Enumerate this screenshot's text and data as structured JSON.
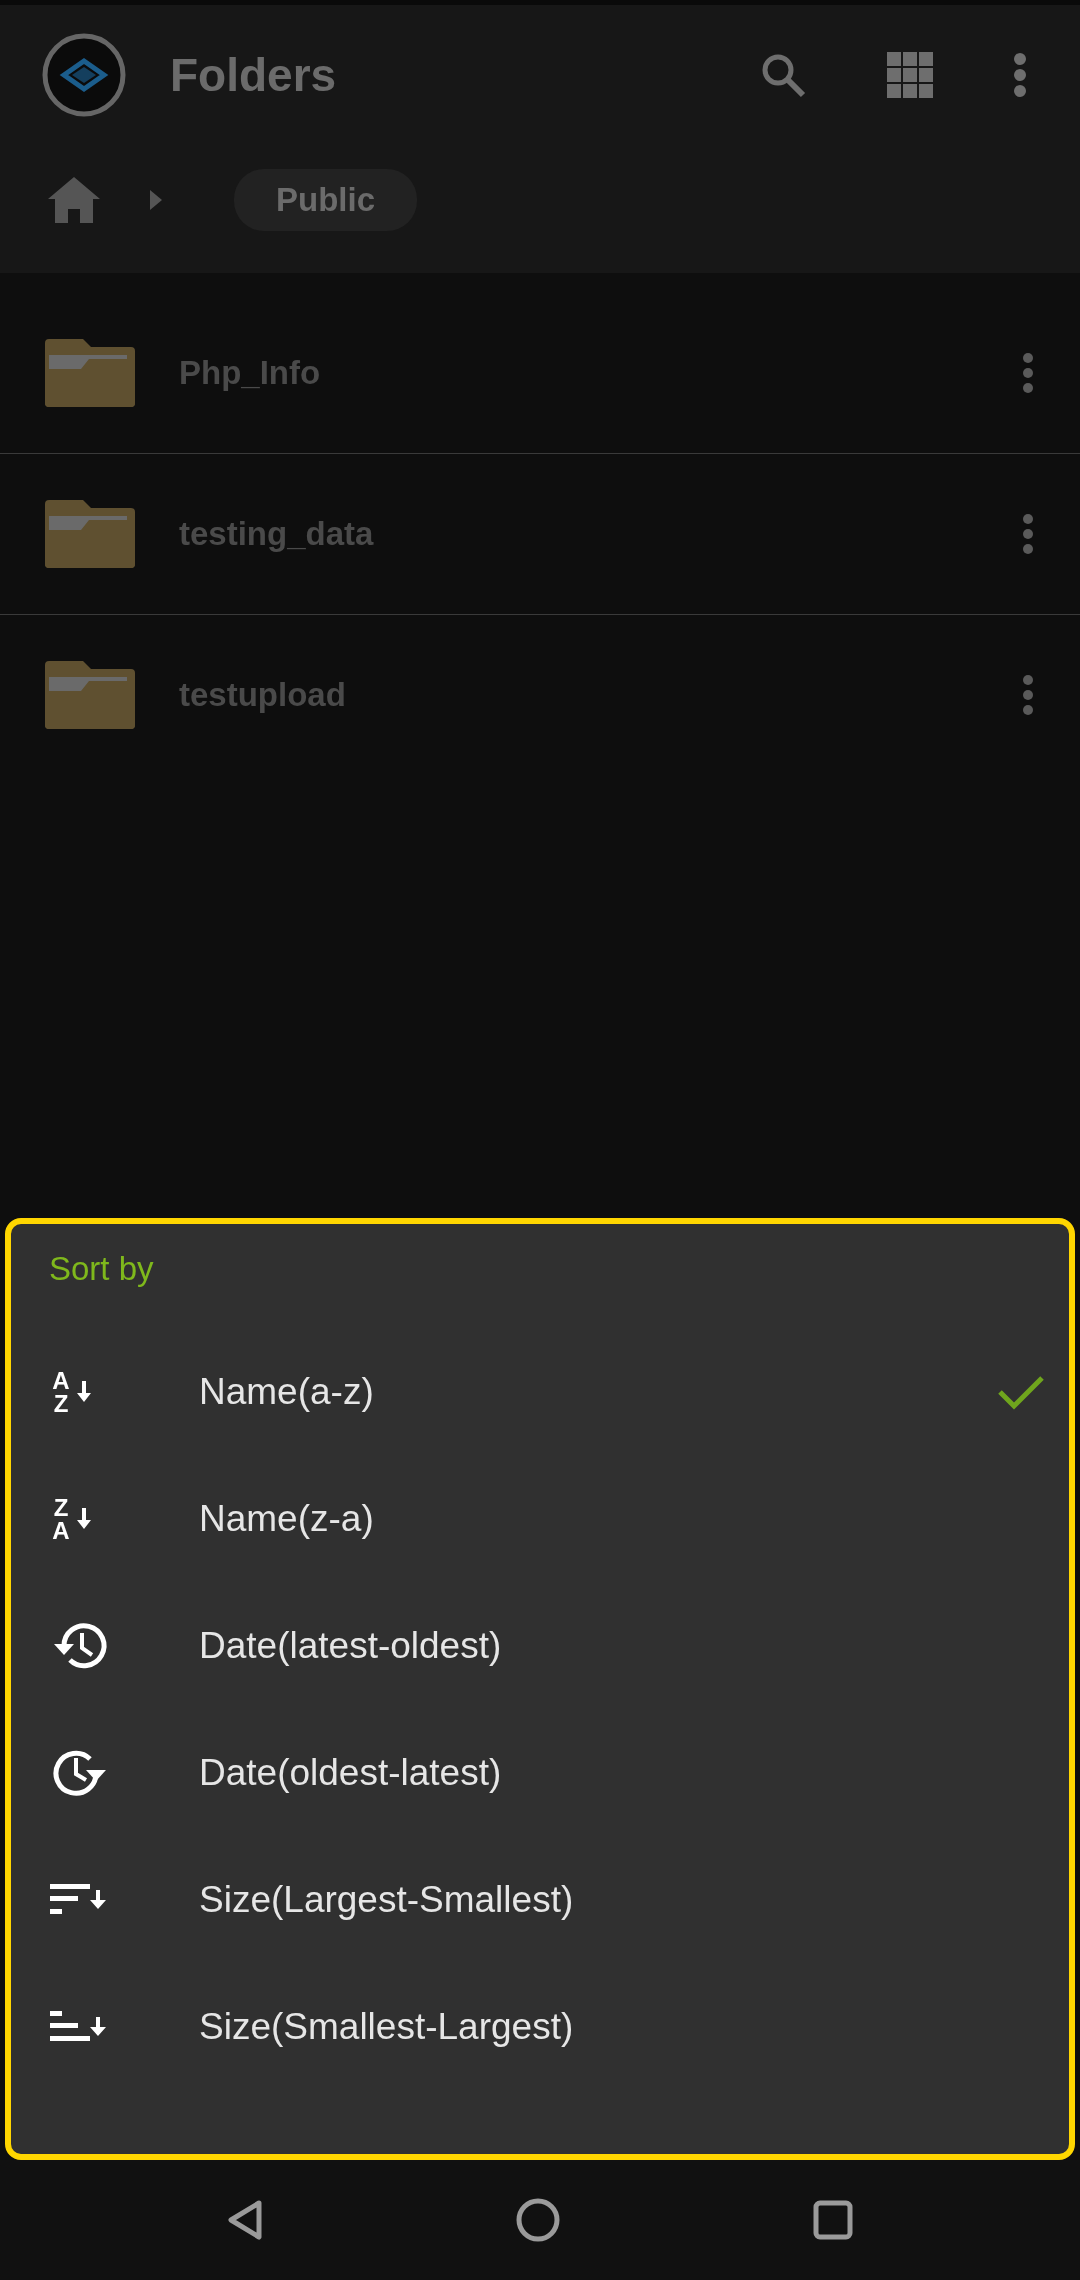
{
  "app_bar": {
    "title": "Folders"
  },
  "breadcrumb": {
    "segments": [
      "Public"
    ]
  },
  "folders": [
    {
      "name": "Php_Info"
    },
    {
      "name": "testing_data"
    },
    {
      "name": "testupload"
    }
  ],
  "sort_sheet": {
    "title": "Sort by",
    "options": [
      {
        "label": "Name(a-z)",
        "kind": "letters",
        "glyphs": [
          "A",
          "Z"
        ],
        "selected": true
      },
      {
        "label": "Name(z-a)",
        "kind": "letters",
        "glyphs": [
          "Z",
          "A"
        ],
        "selected": false
      },
      {
        "label": "Date(latest-oldest)",
        "kind": "history",
        "selected": false
      },
      {
        "label": "Date(oldest-latest)",
        "kind": "clock-forward",
        "selected": false
      },
      {
        "label": "Size(Largest-Smallest)",
        "kind": "bars-descending",
        "selected": false
      },
      {
        "label": "Size(Smallest-Largest)",
        "kind": "bars-ascending",
        "selected": false
      }
    ]
  }
}
